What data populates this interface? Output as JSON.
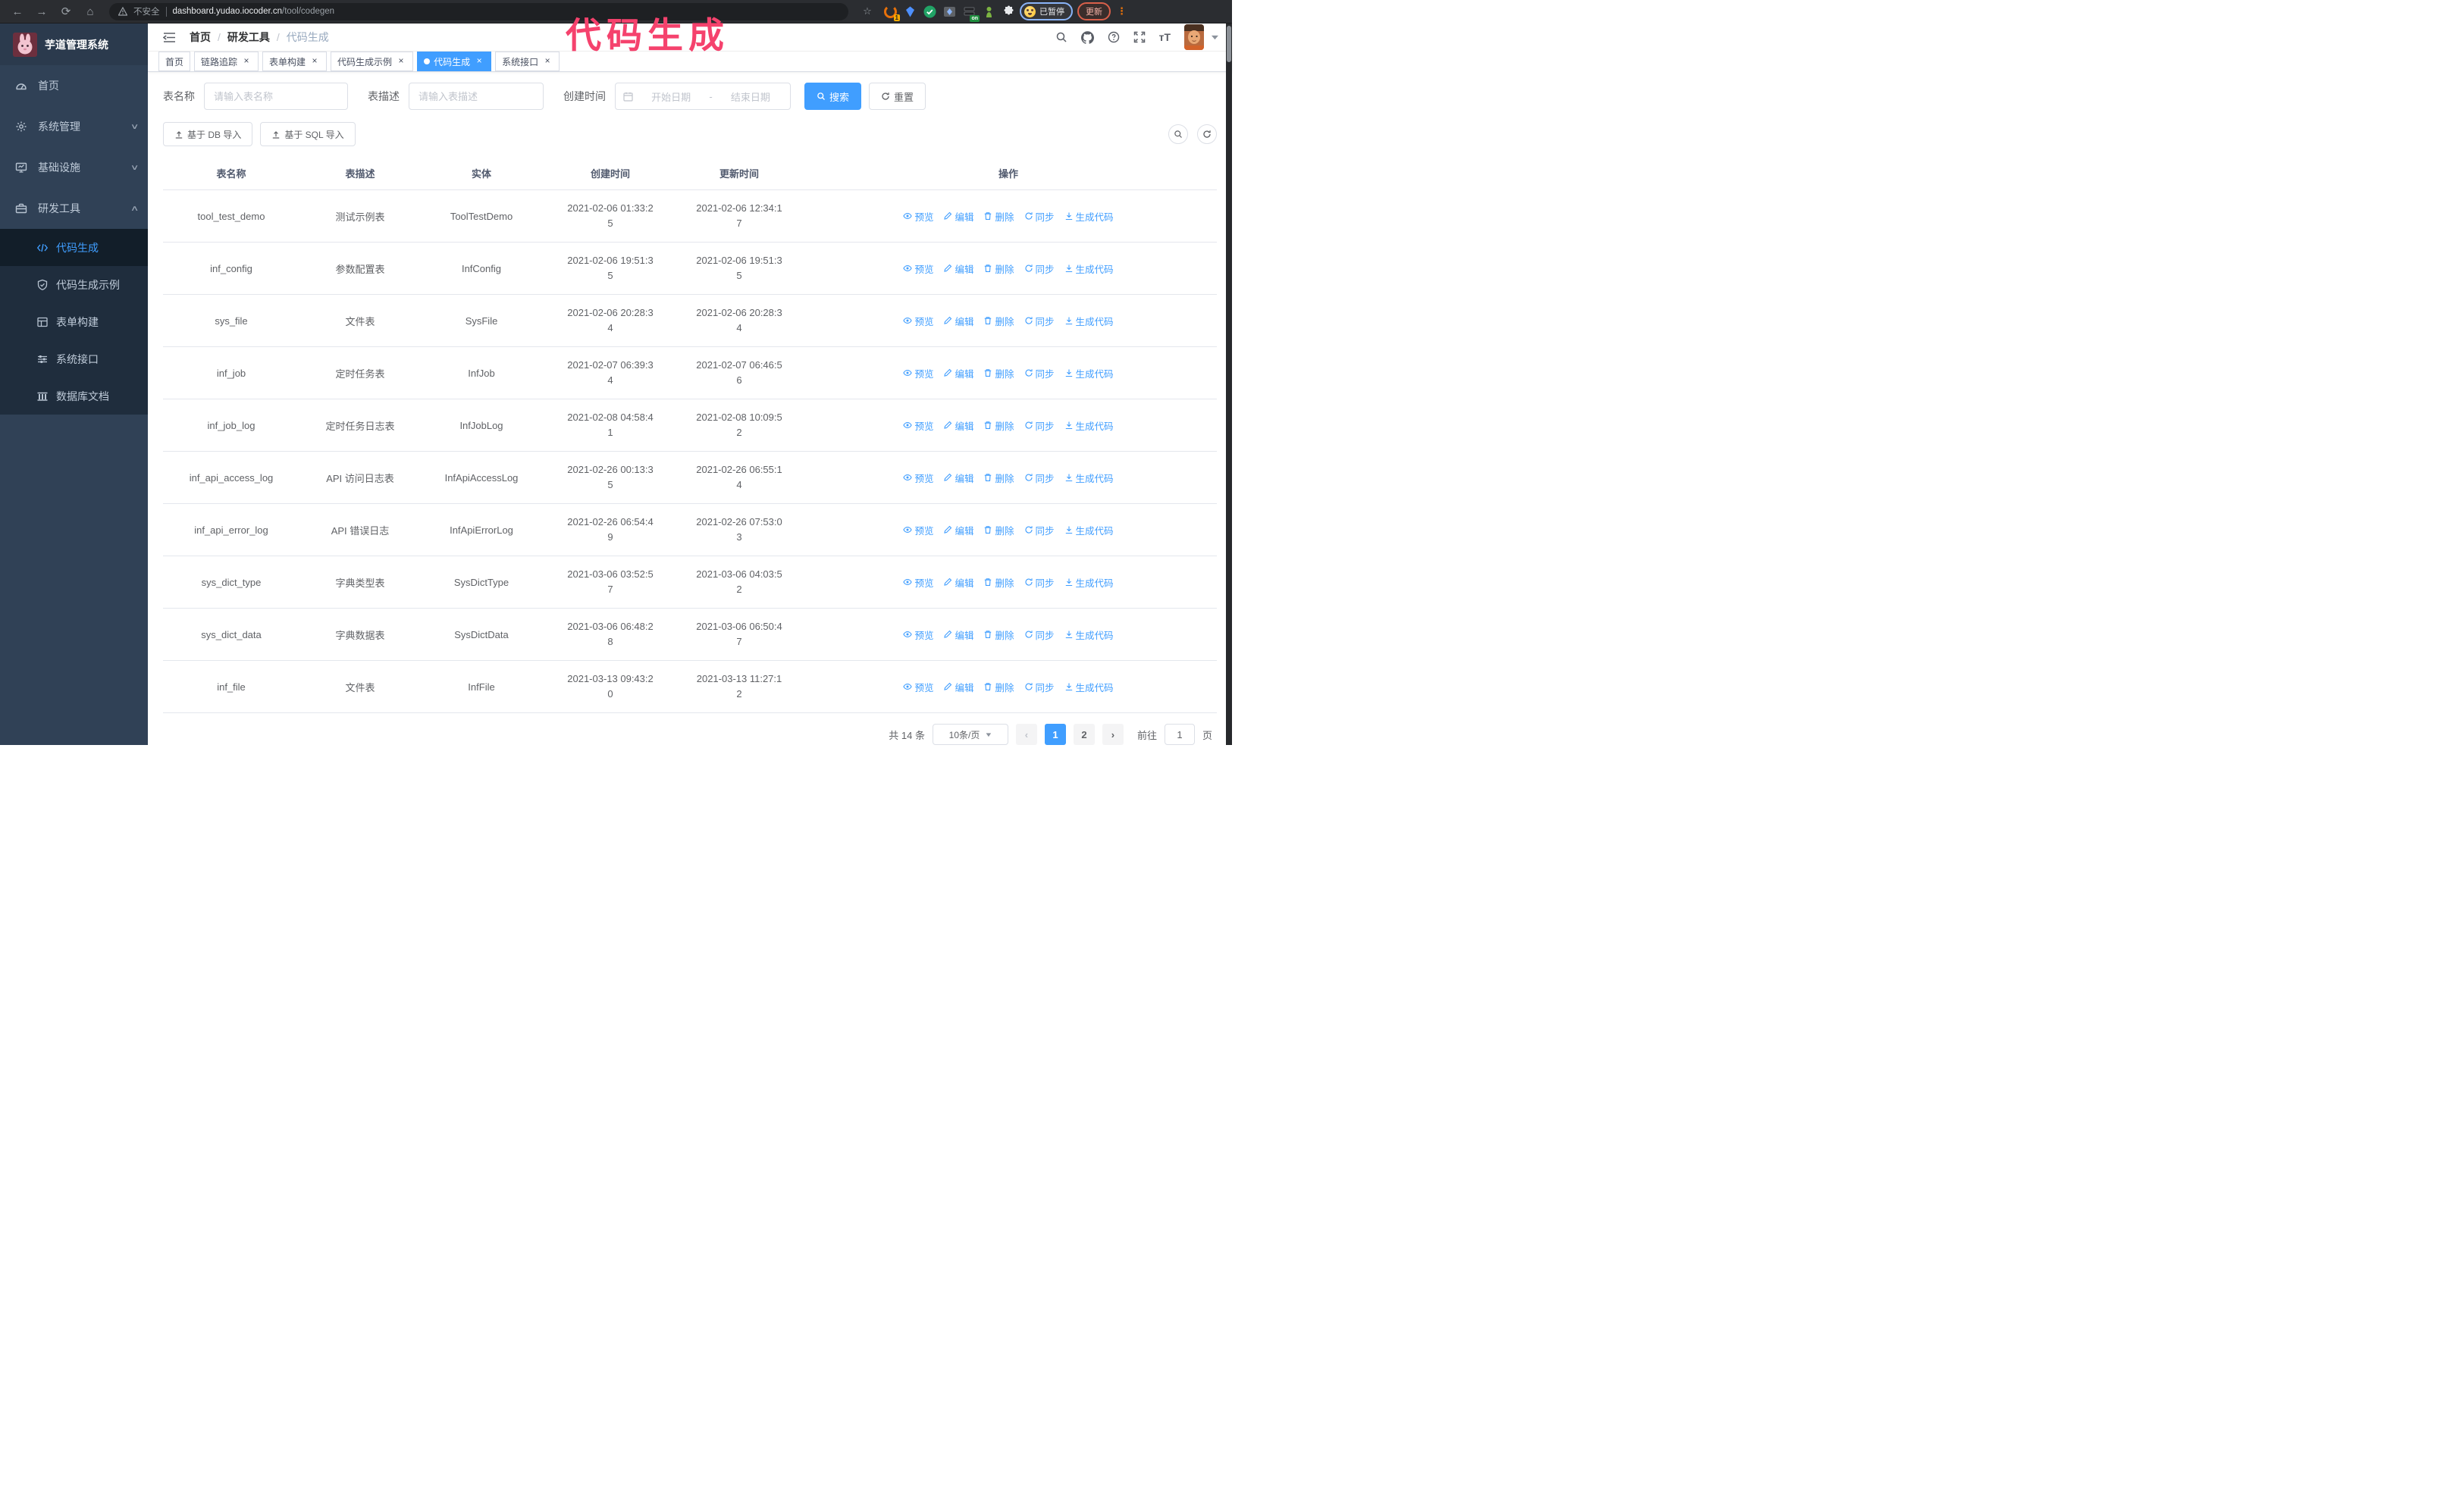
{
  "browser": {
    "security_label": "不安全",
    "url_host": "dashboard.yudao.iocoder.cn",
    "url_path": "/tool/codegen",
    "extension_badge": "1",
    "extension_on_badge": "on",
    "paused_label": "已暂停",
    "update_label": "更新"
  },
  "annotation": {
    "text": "代码生成",
    "color": "#f5426d"
  },
  "sidebar": {
    "logo_title": "芋道管理系统",
    "items": [
      {
        "label": "首页",
        "icon": "dashboard-icon"
      },
      {
        "label": "系统管理",
        "icon": "gear-icon",
        "chevron": "down"
      },
      {
        "label": "基础设施",
        "icon": "monitor-icon",
        "chevron": "down"
      },
      {
        "label": "研发工具",
        "icon": "toolbox-icon",
        "chevron": "up",
        "expanded": true
      }
    ],
    "subitems": [
      {
        "label": "代码生成",
        "icon": "code-icon",
        "active": true
      },
      {
        "label": "代码生成示例",
        "icon": "shield-check-icon"
      },
      {
        "label": "表单构建",
        "icon": "form-icon"
      },
      {
        "label": "系统接口",
        "icon": "sliders-icon"
      },
      {
        "label": "数据库文档",
        "icon": "columns-icon"
      }
    ]
  },
  "navbar": {
    "breadcrumb": [
      "首页",
      "研发工具",
      "代码生成"
    ]
  },
  "tabs": [
    {
      "label": "首页",
      "closable": false
    },
    {
      "label": "链路追踪",
      "closable": true
    },
    {
      "label": "表单构建",
      "closable": true
    },
    {
      "label": "代码生成示例",
      "closable": true
    },
    {
      "label": "代码生成",
      "closable": true,
      "active": true
    },
    {
      "label": "系统接口",
      "closable": true
    }
  ],
  "filters": {
    "table_name_label": "表名称",
    "table_name_placeholder": "请输入表名称",
    "table_desc_label": "表描述",
    "table_desc_placeholder": "请输入表描述",
    "create_time_label": "创建时间",
    "date_start_placeholder": "开始日期",
    "date_separator": "-",
    "date_end_placeholder": "结束日期",
    "search_label": "搜索",
    "reset_label": "重置"
  },
  "toolbar": {
    "import_db_label": "基于 DB 导入",
    "import_sql_label": "基于 SQL 导入"
  },
  "table": {
    "columns": [
      "表名称",
      "表描述",
      "实体",
      "创建时间",
      "更新时间",
      "操作"
    ],
    "actions": [
      "预览",
      "编辑",
      "删除",
      "同步",
      "生成代码"
    ],
    "rows": [
      [
        "tool_test_demo",
        "测试示例表",
        "ToolTestDemo",
        "2021-02-06 01:33:25",
        "2021-02-06 12:34:17"
      ],
      [
        "inf_config",
        "参数配置表",
        "InfConfig",
        "2021-02-06 19:51:35",
        "2021-02-06 19:51:35"
      ],
      [
        "sys_file",
        "文件表",
        "SysFile",
        "2021-02-06 20:28:34",
        "2021-02-06 20:28:34"
      ],
      [
        "inf_job",
        "定时任务表",
        "InfJob",
        "2021-02-07 06:39:34",
        "2021-02-07 06:46:56"
      ],
      [
        "inf_job_log",
        "定时任务日志表",
        "InfJobLog",
        "2021-02-08 04:58:41",
        "2021-02-08 10:09:52"
      ],
      [
        "inf_api_access_log",
        "API 访问日志表",
        "InfApiAccessLog",
        "2021-02-26 00:13:35",
        "2021-02-26 06:55:14"
      ],
      [
        "inf_api_error_log",
        "API 错误日志",
        "InfApiErrorLog",
        "2021-02-26 06:54:49",
        "2021-02-26 07:53:03"
      ],
      [
        "sys_dict_type",
        "字典类型表",
        "SysDictType",
        "2021-03-06 03:52:57",
        "2021-03-06 04:03:52"
      ],
      [
        "sys_dict_data",
        "字典数据表",
        "SysDictData",
        "2021-03-06 06:48:28",
        "2021-03-06 06:50:47"
      ],
      [
        "inf_file",
        "文件表",
        "InfFile",
        "2021-03-13 09:43:20",
        "2021-03-13 11:27:12"
      ]
    ]
  },
  "pagination": {
    "total_label": "共 14 条",
    "page_size_label": "10条/页",
    "pages": [
      "1",
      "2"
    ],
    "active_page": "1",
    "goto_label": "前往",
    "goto_value": "1",
    "page_suffix_label": "页"
  },
  "colors": {
    "accent": "#409EFF",
    "sidebar_bg": "#304156",
    "submenu_bg": "#1f2d3d",
    "active_tab_bg": "#409EFF",
    "annotation": "#f5426d",
    "browser_bar_bg": "#2b2d31"
  }
}
